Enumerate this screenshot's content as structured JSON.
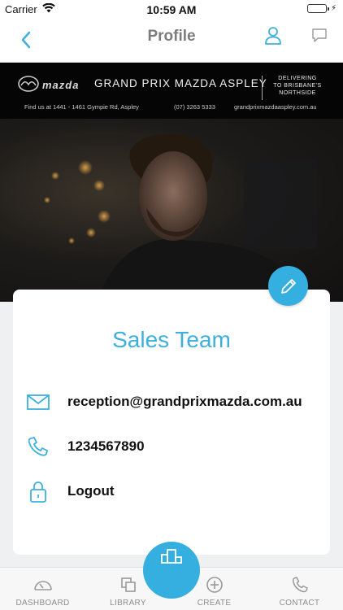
{
  "status_bar": {
    "carrier": "Carrier",
    "time": "10:59 AM",
    "battery_level": 1.0,
    "wifi_icon": "wifi-icon",
    "battery_icon": "battery-icon"
  },
  "nav": {
    "title": "Profile",
    "back_icon": "chevron-left-icon",
    "user_icon": "user-icon",
    "chat_icon": "chat-bubble-icon",
    "accent_color": "#3eb0dd"
  },
  "banner": {
    "brand": "mazda",
    "dealer": "GRAND PRIX MAZDA ASPLEY",
    "tagline": [
      "DELIVERING",
      "TO BRISBANE'S",
      "NORTHSIDE"
    ],
    "address": "Find us at   1441 - 1461 Gympie Rd, Aspley",
    "phone": "(07) 3263 5333",
    "url": "grandprixmazdaaspley.com.au"
  },
  "profile": {
    "name": "Sales Team",
    "email": "reception@grandprixmazda.com.au",
    "phone": "1234567890",
    "logout_label": "Logout",
    "edit_icon": "pencil-icon"
  },
  "tabs": [
    {
      "label": "DASHBOARD",
      "icon": "speedometer-icon"
    },
    {
      "label": "LIBRARY",
      "icon": "copy-icon"
    },
    {
      "label": "CREATE",
      "icon": "plus-circle-icon"
    },
    {
      "label": "CONTACT",
      "icon": "phone-icon"
    }
  ],
  "center_action_icon": "podium-icon",
  "colors": {
    "accent": "#35aee0",
    "tab_label": "#8d8d8d"
  }
}
